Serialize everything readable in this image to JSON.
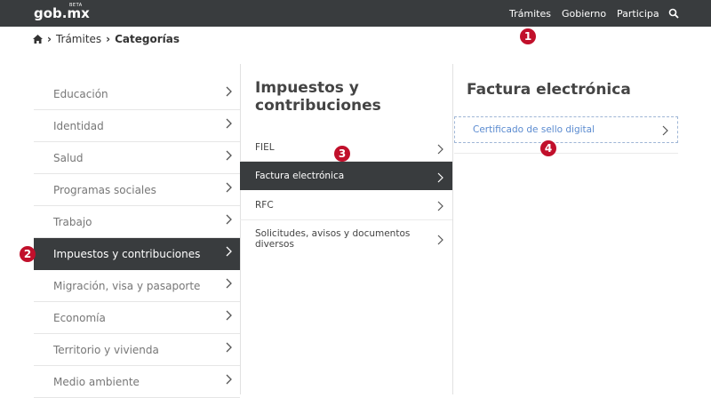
{
  "header": {
    "logo": "gob.mx",
    "logo_badge": "BETA",
    "nav": [
      "Trámites",
      "Gobierno",
      "Participa"
    ],
    "search_icon": "search-icon"
  },
  "breadcrumb": {
    "home_icon": "home-icon",
    "items": [
      "Trámites",
      "Categorías"
    ]
  },
  "categories": [
    {
      "label": "Educación",
      "active": false
    },
    {
      "label": "Identidad",
      "active": false
    },
    {
      "label": "Salud",
      "active": false
    },
    {
      "label": "Programas sociales",
      "active": false
    },
    {
      "label": "Trabajo",
      "active": false
    },
    {
      "label": "Impuestos y contribuciones",
      "active": true
    },
    {
      "label": "Migración, visa y pasaporte",
      "active": false
    },
    {
      "label": "Economía",
      "active": false
    },
    {
      "label": "Territorio y vivienda",
      "active": false
    },
    {
      "label": "Medio ambiente",
      "active": false
    }
  ],
  "subcategories": {
    "title": "Impuestos y contribuciones",
    "items": [
      {
        "label": "FIEL",
        "active": false
      },
      {
        "label": "Factura electrónica",
        "active": true
      },
      {
        "label": "RFC",
        "active": false
      },
      {
        "label": "Solicitudes, avisos y documentos diversos",
        "active": false
      }
    ]
  },
  "procedures": {
    "title": "Factura electrónica",
    "items": [
      {
        "label": "Certificado de sello digital"
      }
    ]
  },
  "badges": [
    "1",
    "2",
    "3",
    "4"
  ],
  "colors": {
    "dark": "#393c3e",
    "badge": "#c1102b",
    "link": "#5b8bd0"
  }
}
